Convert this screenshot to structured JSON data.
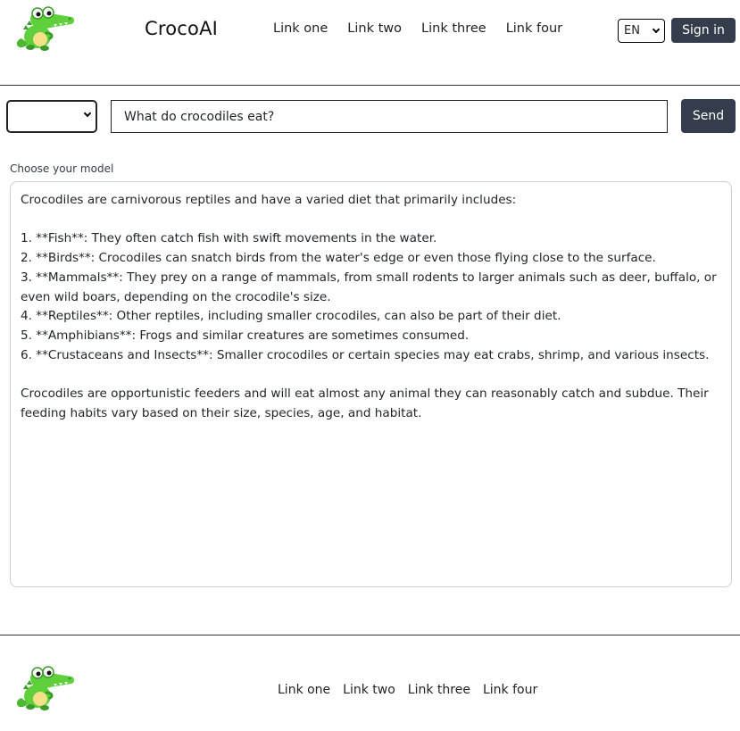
{
  "header": {
    "logo_icon": "crocodile-logo-icon",
    "brand": "CrocoAI",
    "nav": [
      "Link one",
      "Link two",
      "Link three",
      "Link four"
    ],
    "language": "EN",
    "signin_label": "Sign in"
  },
  "query": {
    "model_selected": "",
    "input_value": "What do crocodiles eat?",
    "send_label": "Send",
    "model_label": "Choose your model"
  },
  "response": {
    "text": "Crocodiles are carnivorous reptiles and have a varied diet that primarily includes:\n\n1. **Fish**: They often catch fish with swift movements in the water.\n2. **Birds**: Crocodiles can snatch birds from the water's edge or even those flying close to the surface.\n3. **Mammals**: They prey on a range of mammals, from small rodents to larger animals such as deer, buffalo, or even wild boars, depending on the crocodile's size.\n4. **Reptiles**: Other reptiles, including smaller crocodiles, can also be part of their diet.\n5. **Amphibians**: Frogs and similar creatures are sometimes consumed.\n6. **Crustaceans and Insects**: Smaller crocodiles or certain species may eat crabs, shrimp, and various insects.\n\nCrocodiles are opportunistic feeders and will eat almost any animal they can reasonably catch and subdue. Their feeding habits vary based on their size, species, age, and habitat."
  },
  "footer": {
    "logo_icon": "crocodile-logo-icon",
    "nav": [
      "Link one",
      "Link two",
      "Link three",
      "Link four"
    ]
  },
  "colors": {
    "accent_dark": "#343d4c",
    "croc_green": "#5fcf3c",
    "croc_dark_green": "#3a9a2a"
  }
}
